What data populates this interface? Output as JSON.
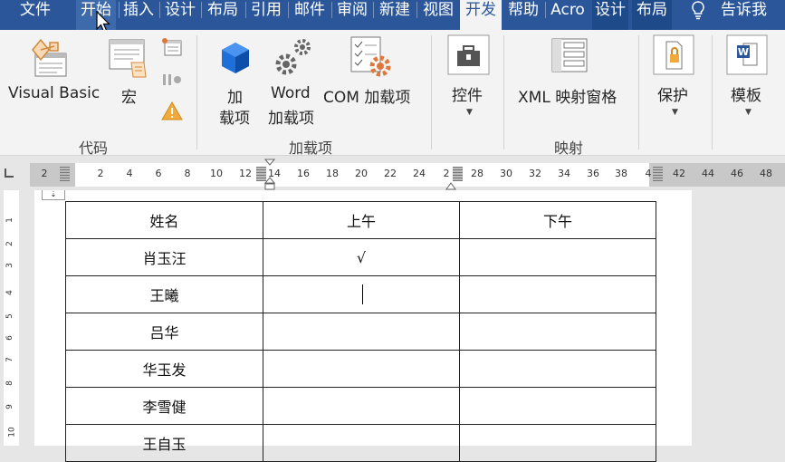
{
  "tabs": [
    {
      "label": "文件"
    },
    {
      "label": "开始"
    },
    {
      "label": "插入"
    },
    {
      "label": "设计"
    },
    {
      "label": "布局"
    },
    {
      "label": "引用"
    },
    {
      "label": "邮件"
    },
    {
      "label": "审阅"
    },
    {
      "label": "新建"
    },
    {
      "label": "视图"
    },
    {
      "label": "开发"
    },
    {
      "label": "帮助"
    },
    {
      "label": "Acro"
    },
    {
      "label": "设计"
    },
    {
      "label": "布局"
    }
  ],
  "tell_me": "告诉我",
  "ribbon": {
    "visual_basic": "Visual Basic",
    "macro": "宏",
    "addin_1": "加",
    "addin_2": "载项",
    "word_addin_1": "Word",
    "word_addin_2": "加载项",
    "com_addin": "COM 加载项",
    "controls": "控件",
    "xml_pane": "XML 映射窗格",
    "protect": "保护",
    "template": "模板",
    "groups": {
      "code": "代码",
      "addins": "加载项",
      "mapping": "映射"
    }
  },
  "ruler": {
    "numbers": [
      "2",
      "2",
      "4",
      "6",
      "8",
      "10",
      "12",
      "14",
      "16",
      "18",
      "20",
      "22",
      "24",
      "2",
      "28",
      "30",
      "32",
      "34",
      "36",
      "38",
      "4",
      "42",
      "44",
      "46",
      "48"
    ]
  },
  "vruler": [
    "1",
    "2",
    "3",
    "4",
    "5",
    "6",
    "7",
    "8",
    "9",
    "10"
  ],
  "table": {
    "headers": [
      "姓名",
      "上午",
      "下午"
    ],
    "rows": [
      [
        "肖玉汪",
        "√",
        ""
      ],
      [
        "王曦",
        "",
        ""
      ],
      [
        "吕华",
        "",
        ""
      ],
      [
        "华玉发",
        "",
        ""
      ],
      [
        "李雪健",
        "",
        ""
      ],
      [
        "王自玉",
        "",
        ""
      ]
    ]
  },
  "colors": {
    "accent": "#2b579a",
    "ribbon_bg": "#f3f3f3",
    "doc_bg": "#e6e6e6"
  }
}
